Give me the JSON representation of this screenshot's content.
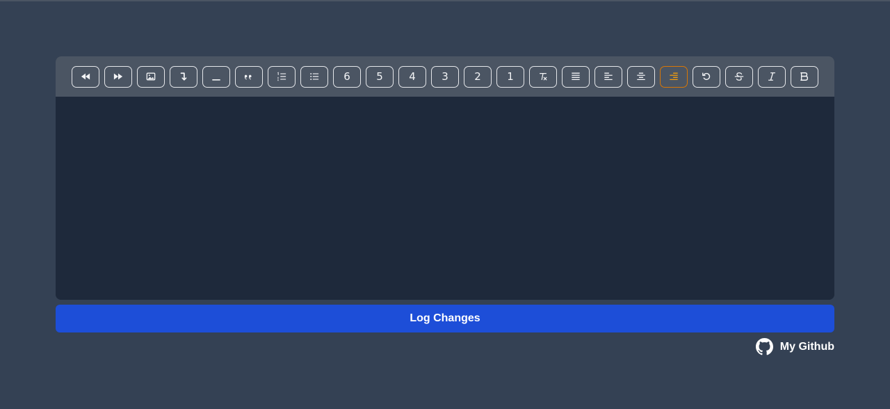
{
  "toolbar": {
    "buttons": [
      {
        "name": "undo-rewind-button",
        "icon": "backward-icon",
        "label": ""
      },
      {
        "name": "redo-forward-button",
        "icon": "forward-icon",
        "label": ""
      },
      {
        "name": "insert-image-button",
        "icon": "image-icon",
        "label": ""
      },
      {
        "name": "line-break-button",
        "icon": "arrow-turn-down-icon",
        "label": ""
      },
      {
        "name": "horizontal-rule-button",
        "icon": "horizontal-rule-icon",
        "label": ""
      },
      {
        "name": "blockquote-button",
        "icon": "quote-icon",
        "label": ""
      },
      {
        "name": "ordered-list-button",
        "icon": "ordered-list-icon",
        "label": ""
      },
      {
        "name": "bullet-list-button",
        "icon": "bullet-list-icon",
        "label": ""
      },
      {
        "name": "heading-6-button",
        "icon": "",
        "label": "6"
      },
      {
        "name": "heading-5-button",
        "icon": "",
        "label": "5"
      },
      {
        "name": "heading-4-button",
        "icon": "",
        "label": "4"
      },
      {
        "name": "heading-3-button",
        "icon": "",
        "label": "3"
      },
      {
        "name": "heading-2-button",
        "icon": "",
        "label": "2"
      },
      {
        "name": "heading-1-button",
        "icon": "",
        "label": "1"
      },
      {
        "name": "clear-format-button",
        "icon": "clear-format-icon",
        "label": ""
      },
      {
        "name": "align-justify-button",
        "icon": "align-justify-icon",
        "label": ""
      },
      {
        "name": "align-left-button",
        "icon": "align-left-icon",
        "label": ""
      },
      {
        "name": "align-center-button",
        "icon": "align-center-icon",
        "label": ""
      },
      {
        "name": "align-right-button",
        "icon": "align-right-icon",
        "label": "",
        "active": true
      },
      {
        "name": "undo-button",
        "icon": "rotate-left-icon",
        "label": ""
      },
      {
        "name": "strikethrough-button",
        "icon": "strikethrough-icon",
        "label": ""
      },
      {
        "name": "italic-button",
        "icon": "italic-icon",
        "label": ""
      },
      {
        "name": "bold-button",
        "icon": "bold-icon",
        "label": ""
      }
    ],
    "active_color": "#f59e0b"
  },
  "editor": {
    "content": ""
  },
  "actions": {
    "log_label": "Log Changes",
    "log_color": "#1d4ed8"
  },
  "footer": {
    "github_label": "My Github",
    "github_icon": "github-icon"
  }
}
